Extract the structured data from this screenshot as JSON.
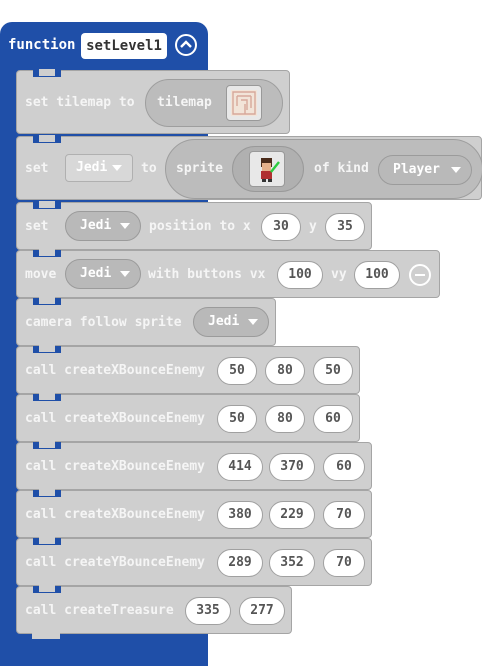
{
  "function": {
    "keyword": "function",
    "name": "setLevel1"
  },
  "blocks": {
    "set_tilemap": {
      "prefix": "set tilemap to",
      "pill": "tilemap"
    },
    "set_sprite": {
      "set": "set",
      "var": "Jedi",
      "to": "to",
      "sprite": "sprite",
      "of_kind": "of kind",
      "kind": "Player"
    },
    "set_position": {
      "set": "set",
      "var": "Jedi",
      "text": "position to x",
      "x": "30",
      "y_label": "y",
      "y": "35"
    },
    "move": {
      "prefix": "move",
      "var": "Jedi",
      "text": "with buttons vx",
      "vx": "100",
      "vy_label": "vy",
      "vy": "100"
    },
    "camera": {
      "text": "camera follow sprite",
      "var": "Jedi"
    },
    "calls": [
      {
        "text": "call createXBounceEnemy",
        "args": [
          "50",
          "80",
          "50"
        ]
      },
      {
        "text": "call createXBounceEnemy",
        "args": [
          "50",
          "80",
          "60"
        ]
      },
      {
        "text": "call createXBounceEnemy",
        "args": [
          "414",
          "370",
          "60"
        ]
      },
      {
        "text": "call createXBounceEnemy",
        "args": [
          "380",
          "229",
          "70"
        ]
      },
      {
        "text": "call createYBounceEnemy",
        "args": [
          "289",
          "352",
          "70"
        ]
      },
      {
        "text": "call createTreasure",
        "args": [
          "335",
          "277"
        ]
      }
    ]
  },
  "colors": {
    "function_block": "#1f4fa8",
    "statement_block": "#cfcfcf",
    "text": "#f5f5f5"
  }
}
